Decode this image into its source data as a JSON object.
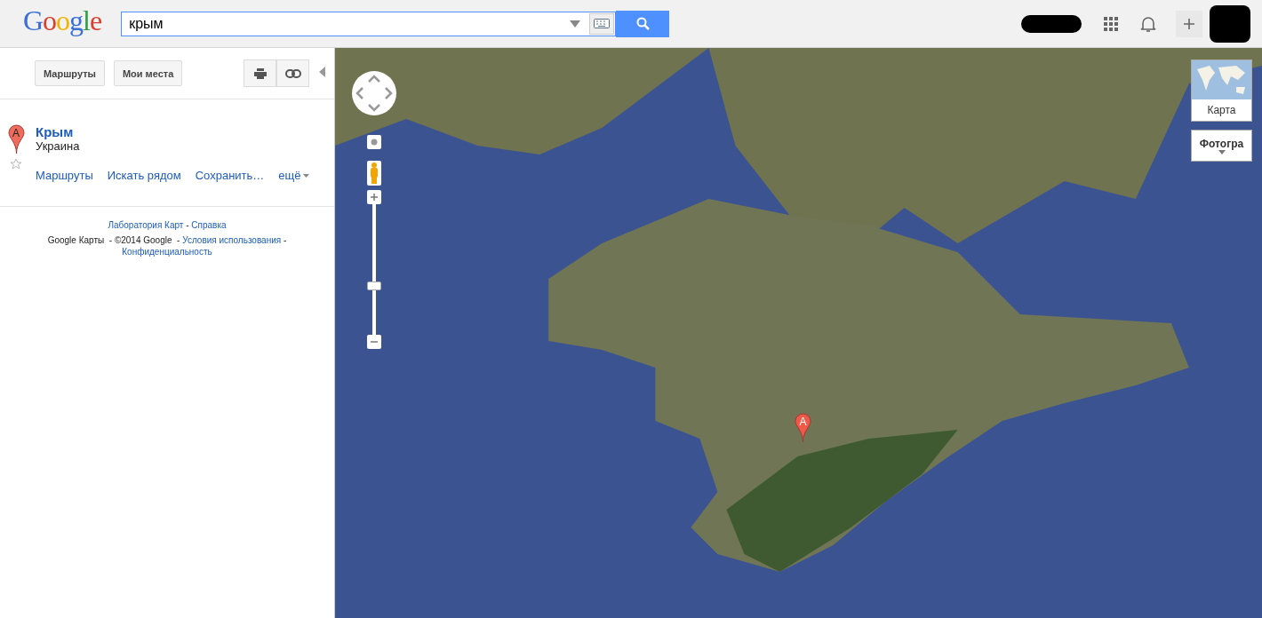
{
  "header": {
    "logo": "Google",
    "search": {
      "value": "крым"
    }
  },
  "sidebar": {
    "buttons": [
      "Маршруты",
      "Мои места"
    ],
    "result": {
      "marker": "A",
      "title": "Крым",
      "subtitle": "Украина",
      "starred": false,
      "actions": [
        "Маршруты",
        "Искать рядом",
        "Сохранить…"
      ],
      "more": "ещё"
    },
    "footer": {
      "separator": "-",
      "links": [
        "Лаборатория Карт",
        "Справка"
      ],
      "product": "Google Карты",
      "copyright": "©2014 Google",
      "legal": [
        "Условия использования",
        "Конфиденциальность"
      ]
    }
  },
  "map": {
    "marker": "A",
    "zoom": {
      "level": 0.38
    },
    "types": [
      {
        "label": "Карта",
        "selected": false,
        "kind": "thumb"
      },
      {
        "label": "Фотогра",
        "selected": true,
        "kind": "dropdown"
      }
    ]
  }
}
